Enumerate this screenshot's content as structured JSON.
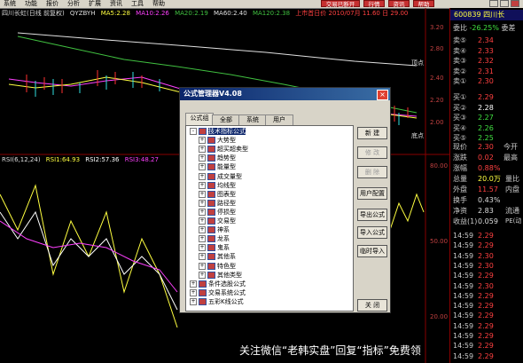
{
  "menu": {
    "items": [
      "系统",
      "功能",
      "报价",
      "分析",
      "扩展",
      "资讯",
      "工具",
      "帮助"
    ]
  },
  "toolbar": {
    "btn1": "交易已断开",
    "btn2": "行情",
    "btn3": "资讯",
    "btn4": "帮助"
  },
  "chart_title": {
    "name": "四川长虹(日线 前复权)",
    "qyzbyh": "QYZBYH",
    "ma5": "MA5:2.28",
    "ma10": "MA10:2.26",
    "ma20": "MA20:2.19",
    "ma60": "MA60:2.40",
    "ma120": "MA120:2.38",
    "date": "上市首日价 2010/07月 11.60 日 29.00"
  },
  "axis": {
    "a1": "3.20",
    "a2": "2.80",
    "a3": "2.40",
    "a4": "2.20",
    "a5": "2.00",
    "b1": "80.00",
    "b2": "50.00",
    "b3": "20.00"
  },
  "markers": {
    "top": "顶点",
    "bottom": "底点"
  },
  "rsi": {
    "label": "RSI(6,12,24)",
    "r1": "RSI1:64.93",
    "r2": "RSI2:57.36",
    "r3": "RSI3:48.27"
  },
  "right": {
    "code": "600839",
    "name": "四川长",
    "ratio_label": "委比",
    "ratio": "-26.25%",
    "diff_label": "委差",
    "sells": [
      {
        "l": "卖⑤",
        "v": "2.34"
      },
      {
        "l": "卖④",
        "v": "2.33"
      },
      {
        "l": "卖③",
        "v": "2.32"
      },
      {
        "l": "卖②",
        "v": "2.31"
      },
      {
        "l": "卖①",
        "v": "2.30"
      }
    ],
    "buys": [
      {
        "l": "买①",
        "v": "2.29"
      },
      {
        "l": "买②",
        "v": "2.28"
      },
      {
        "l": "买③",
        "v": "2.27"
      },
      {
        "l": "买④",
        "v": "2.26"
      },
      {
        "l": "买⑤",
        "v": "2.25"
      }
    ],
    "stats": [
      {
        "l": "现价",
        "v": "2.30",
        "c": "#ff4040"
      },
      {
        "l": "涨跌",
        "v": "0.02",
        "c": "#ff4040"
      },
      {
        "l": "涨幅",
        "v": "0.88%",
        "c": "#ff4040"
      },
      {
        "l": "总量",
        "v": "20.0万",
        "c": "#ffff40"
      },
      {
        "l": "外盘",
        "v": "11.57",
        "c": "#ff4040"
      },
      {
        "l": "换手",
        "v": "0.43%",
        "c": "#ddd"
      },
      {
        "l": "净资",
        "v": "2.83",
        "c": "#ddd"
      },
      {
        "l": "收益(1)",
        "v": "0.059",
        "c": "#ddd"
      }
    ],
    "ticks": [
      {
        "t": "14:59",
        "v": "2.29"
      },
      {
        "t": "14:59",
        "v": "2.29"
      },
      {
        "t": "14:59",
        "v": "2.30"
      },
      {
        "t": "14:59",
        "v": "2.30"
      },
      {
        "t": "14:59",
        "v": "2.29"
      },
      {
        "t": "14:59",
        "v": "2.30"
      },
      {
        "t": "14:59",
        "v": "2.29"
      },
      {
        "t": "14:59",
        "v": "2.29"
      },
      {
        "t": "14:59",
        "v": "2.29"
      },
      {
        "t": "14:59",
        "v": "2.29"
      },
      {
        "t": "14:59",
        "v": "2.29"
      },
      {
        "t": "14:59",
        "v": "2.29"
      },
      {
        "t": "14:59",
        "v": "2.29"
      }
    ],
    "side": {
      "s1": "今开",
      "s2": "最高",
      "s3": "量比",
      "s4": "内盘",
      "s5": "流通",
      "s6": "PE(动"
    }
  },
  "dialog": {
    "title": "公式管理器V4.08",
    "close": "×",
    "tabs": [
      "公式组",
      "全部",
      "系统",
      "用户"
    ],
    "buttons": [
      "新 建",
      "修 改",
      "删 除",
      "用户配置",
      "导出公式",
      "导入公式",
      "临时导入",
      "关 闭"
    ],
    "tree": [
      {
        "t": "技术指标公式",
        "pm": "-",
        "lv": 0,
        "sel": true
      },
      {
        "t": "大势型",
        "pm": "+",
        "lv": 1
      },
      {
        "t": "超买超卖型",
        "pm": "+",
        "lv": 1
      },
      {
        "t": "趋势型",
        "pm": "+",
        "lv": 1
      },
      {
        "t": "能量型",
        "pm": "+",
        "lv": 1
      },
      {
        "t": "成交量型",
        "pm": "+",
        "lv": 1
      },
      {
        "t": "均线型",
        "pm": "+",
        "lv": 1
      },
      {
        "t": "图表型",
        "pm": "+",
        "lv": 1
      },
      {
        "t": "路径型",
        "pm": "+",
        "lv": 1
      },
      {
        "t": "停损型",
        "pm": "+",
        "lv": 1
      },
      {
        "t": "交易型",
        "pm": "+",
        "lv": 1
      },
      {
        "t": "神系",
        "pm": "+",
        "lv": 1
      },
      {
        "t": "龙系",
        "pm": "+",
        "lv": 1
      },
      {
        "t": "鬼系",
        "pm": "+",
        "lv": 1
      },
      {
        "t": "其他系",
        "pm": "+",
        "lv": 1
      },
      {
        "t": "特色型",
        "pm": "+",
        "lv": 1
      },
      {
        "t": "其他类型",
        "pm": "+",
        "lv": 1
      },
      {
        "t": "条件选股公式",
        "pm": "+",
        "lv": 0
      },
      {
        "t": "交易系统公式",
        "pm": "+",
        "lv": 0
      },
      {
        "t": "五彩K线公式",
        "pm": "+",
        "lv": 0
      }
    ]
  },
  "watermark": "关注微信“老韩实盘”回复“指标”免费领"
}
